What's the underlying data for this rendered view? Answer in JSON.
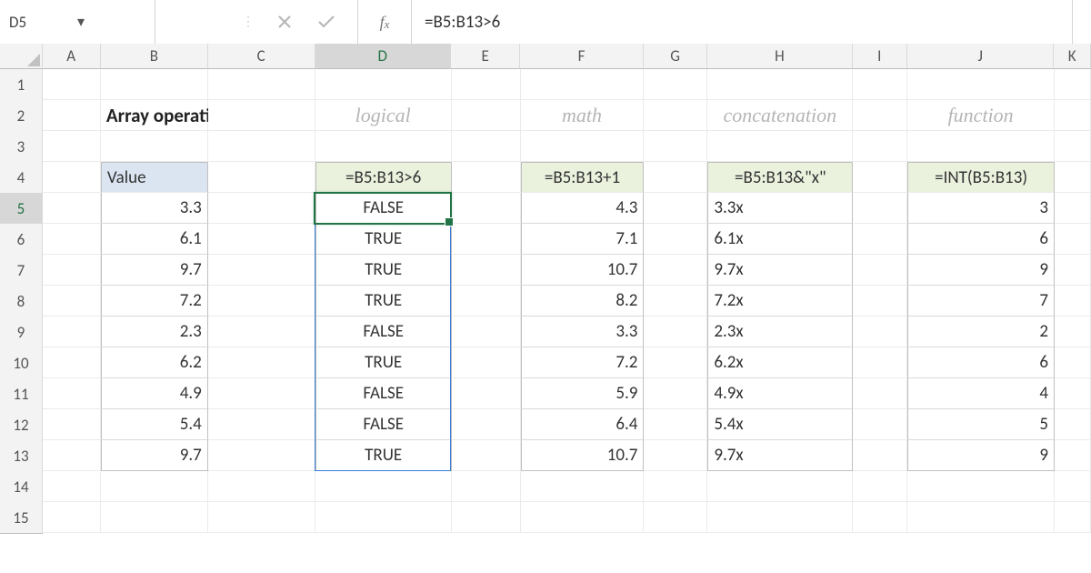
{
  "formula_bar": {
    "cell_ref": "D5",
    "formula": "=B5:B13>6"
  },
  "columns": [
    "A",
    "B",
    "C",
    "D",
    "E",
    "F",
    "G",
    "H",
    "I",
    "J",
    "K"
  ],
  "row_numbers": [
    1,
    2,
    3,
    4,
    5,
    6,
    7,
    8,
    9,
    10,
    11,
    12,
    13,
    14,
    15
  ],
  "active": {
    "col": "D",
    "row": 5,
    "spill_rows": 9
  },
  "titles": {
    "main": "Array operation",
    "logical": "logical",
    "math": "math",
    "concat": "concatenation",
    "func": "function"
  },
  "headers": {
    "value": "Value",
    "d": "=B5:B13>6",
    "f": "=B5:B13+1",
    "h": "=B5:B13&\"x\"",
    "j": "=INT(B5:B13)"
  },
  "rowsdata": [
    {
      "b": "3.3",
      "d": "FALSE",
      "f": "4.3",
      "h": "3.3x",
      "j": "3"
    },
    {
      "b": "6.1",
      "d": "TRUE",
      "f": "7.1",
      "h": "6.1x",
      "j": "6"
    },
    {
      "b": "9.7",
      "d": "TRUE",
      "f": "10.7",
      "h": "9.7x",
      "j": "9"
    },
    {
      "b": "7.2",
      "d": "TRUE",
      "f": "8.2",
      "h": "7.2x",
      "j": "7"
    },
    {
      "b": "2.3",
      "d": "FALSE",
      "f": "3.3",
      "h": "2.3x",
      "j": "2"
    },
    {
      "b": "6.2",
      "d": "TRUE",
      "f": "7.2",
      "h": "6.2x",
      "j": "6"
    },
    {
      "b": "4.9",
      "d": "FALSE",
      "f": "5.9",
      "h": "4.9x",
      "j": "4"
    },
    {
      "b": "5.4",
      "d": "FALSE",
      "f": "6.4",
      "h": "5.4x",
      "j": "5"
    },
    {
      "b": "9.7",
      "d": "TRUE",
      "f": "10.7",
      "h": "9.7x",
      "j": "9"
    }
  ]
}
